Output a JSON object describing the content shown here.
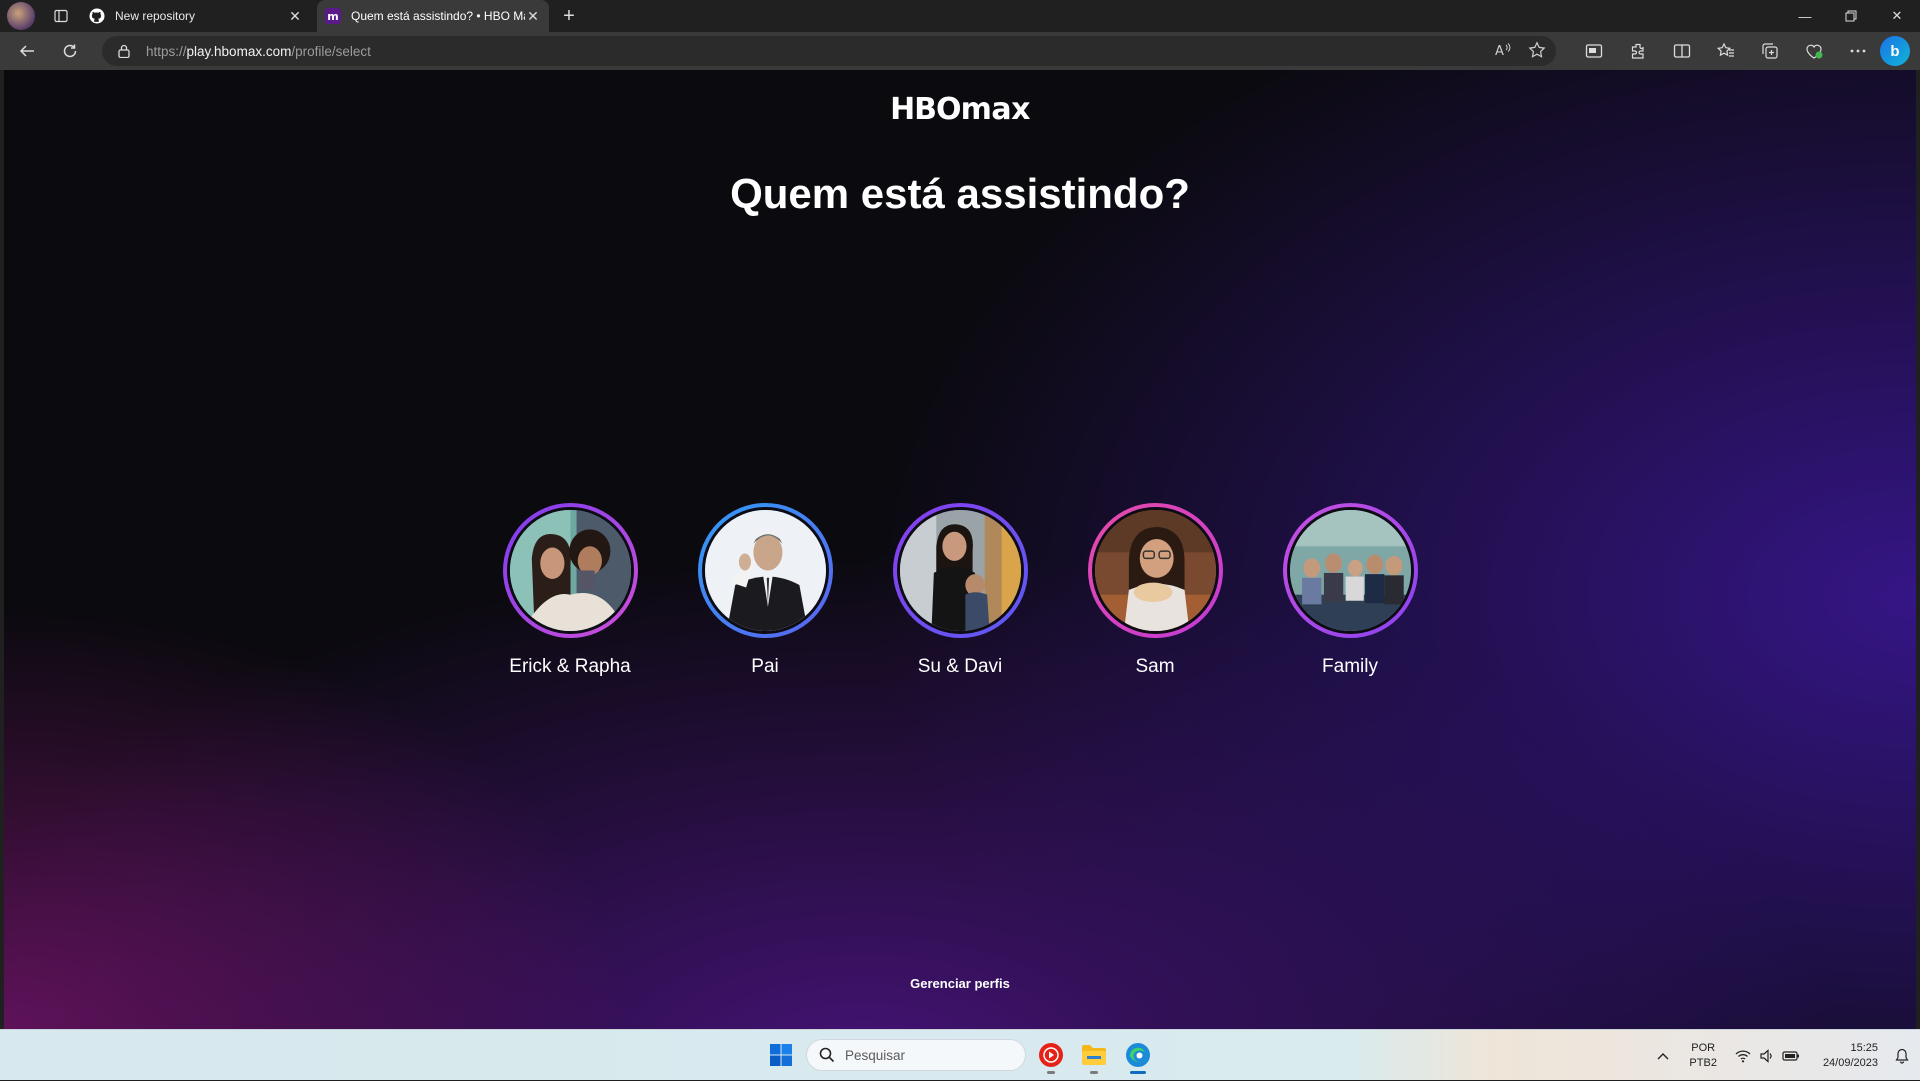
{
  "browser": {
    "tabs": [
      {
        "title": "New repository",
        "favicon": "github-icon",
        "active": false
      },
      {
        "title": "Quem está assistindo? • HBO Max",
        "favicon": "hbomax-icon",
        "active": true
      }
    ],
    "address": {
      "scheme": "https://",
      "host": "play.hbomax.com",
      "path": "/profile/select"
    },
    "toolbar_icons": [
      "read-aloud-icon",
      "favorite-star-icon",
      "screen-cast-icon",
      "extensions-icon",
      "split-screen-icon",
      "favorites-icon",
      "collections-icon",
      "browser-essentials-icon",
      "more-icon",
      "bing-chat-icon"
    ],
    "bing_label": "b"
  },
  "page": {
    "logo": {
      "hbo": "HBO",
      "max": "max"
    },
    "heading": "Quem está assistindo?",
    "profiles": [
      {
        "name": "Erick & Rapha",
        "ring": [
          "#7b3cf0",
          "#d04fd9"
        ]
      },
      {
        "name": "Pai",
        "ring": [
          "#2f9cf5",
          "#5c63f0"
        ]
      },
      {
        "name": "Su & Davi",
        "ring": [
          "#8a3df0",
          "#5a5cf2"
        ]
      },
      {
        "name": "Sam",
        "ring": [
          "#e84aa8",
          "#c23ad8"
        ]
      },
      {
        "name": "Family",
        "ring": [
          "#c94fe0",
          "#8a43f0"
        ]
      }
    ],
    "manage_label": "Gerenciar perfis"
  },
  "taskbar": {
    "search_placeholder": "Pesquisar",
    "apps": [
      "youtube-music-icon",
      "file-explorer-icon",
      "edge-icon"
    ],
    "language": {
      "line1": "POR",
      "line2": "PTB2"
    },
    "time": "15:25",
    "date": "24/09/2023"
  }
}
